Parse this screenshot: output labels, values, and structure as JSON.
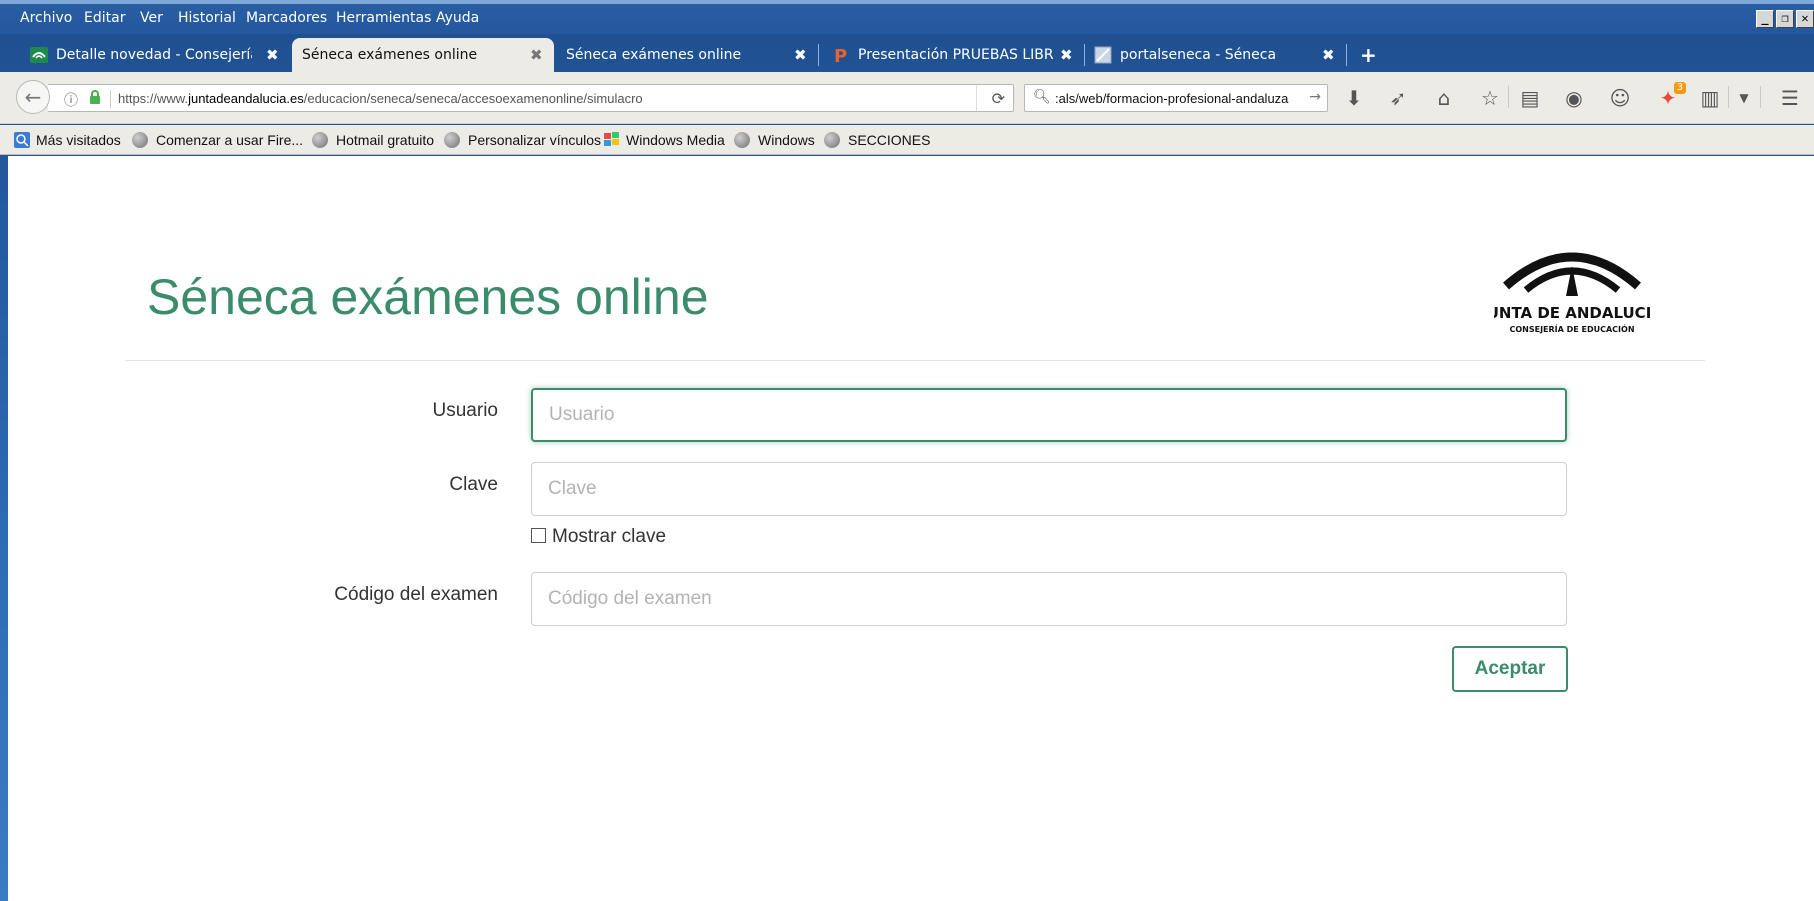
{
  "menu": {
    "items": [
      "Archivo",
      "Editar",
      "Ver",
      "Historial",
      "Marcadores",
      "Herramientas",
      "Ayuda"
    ]
  },
  "window_controls": {
    "minimize": "_",
    "restore": "❐",
    "close": "✕"
  },
  "tabs": [
    {
      "label": "Detalle novedad - Consejería ...",
      "close": "✖",
      "icon": "junta-logo-icon"
    },
    {
      "label": "Séneca exámenes online",
      "close": "✖",
      "active": true
    },
    {
      "label": "Séneca exámenes online",
      "close": "✖"
    },
    {
      "label": "Presentación PRUEBAS LIBRE...",
      "close": "✖",
      "icon": "p-presentation-icon"
    },
    {
      "label": "portalseneca - Séneca",
      "close": "✖",
      "icon": "page-icon"
    }
  ],
  "new_tab": "+",
  "navbar": {
    "url_prefix": "https://www.",
    "url_domain": "juntadeandalucia.es",
    "url_path": "/educacion/seneca/seneca/accesoexamenonline/simulacro",
    "search_text": ":als/web/formacion-profesional-andaluza",
    "badge_count": "3"
  },
  "bookmarks": [
    {
      "label": "Más visitados",
      "icon": "most-visited-icon"
    },
    {
      "label": "Comenzar a usar Fire...",
      "icon": "globe-icon"
    },
    {
      "label": "Hotmail gratuito",
      "icon": "globe-icon"
    },
    {
      "label": "Personalizar vínculos",
      "icon": "globe-icon"
    },
    {
      "label": "Windows Media",
      "icon": "windows-media-icon"
    },
    {
      "label": "Windows",
      "icon": "globe-icon"
    },
    {
      "label": "SECCIONES",
      "icon": "globe-icon"
    }
  ],
  "page": {
    "title": "Séneca exámenes online",
    "logo_text": "JUNTA DE ANDALUCIA",
    "logo_subtext": "CONSEJERÍA DE EDUCACIÓN",
    "usuario_label": "Usuario",
    "usuario_placeholder": "Usuario",
    "clave_label": "Clave",
    "clave_placeholder": "Clave",
    "mostrar_clave_label": "Mostrar clave",
    "codigo_label": "Código del examen",
    "codigo_placeholder": "Código del examen",
    "submit_label": "Aceptar"
  },
  "colors": {
    "accent": "#3b8c6a",
    "chrome_blue": "#2a5ea3",
    "toolbar_bg": "#ecebe6"
  }
}
